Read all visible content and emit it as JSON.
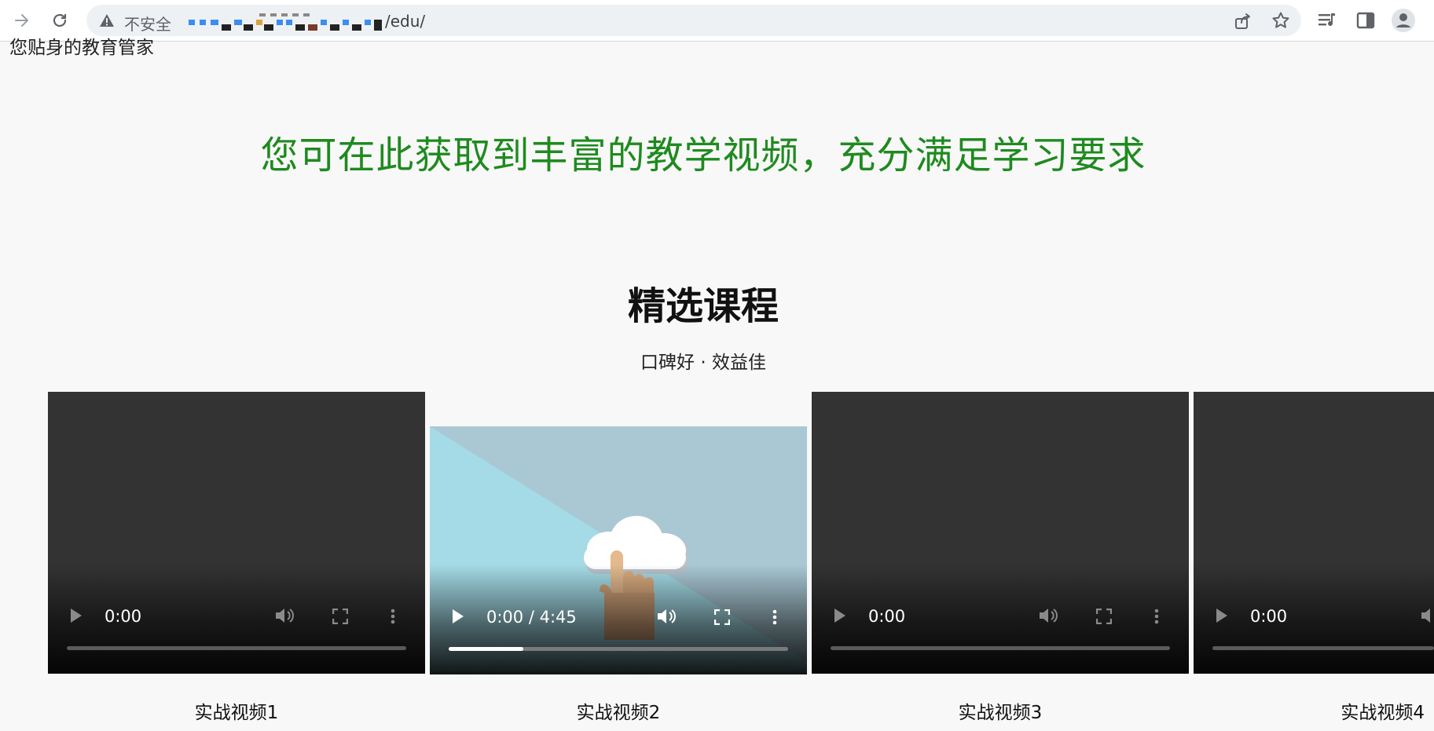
{
  "browser": {
    "security_label": "不安全",
    "url_path": "/edu/"
  },
  "page": {
    "tagline": "您贴身的教育管家",
    "hero_text": "您可在此获取到丰富的教学视频，充分满足学习要求",
    "section_title": "精选课程",
    "section_subtitle": "口碑好 · 效益佳"
  },
  "videos": [
    {
      "label": "实战视频1",
      "time": "0:00",
      "progress": 0
    },
    {
      "label": "实战视频2",
      "time": "0:00 / 4:45",
      "progress": 0.22
    },
    {
      "label": "实战视频3",
      "time": "0:00",
      "progress": 0
    },
    {
      "label": "实战视频4",
      "time": "0:00",
      "progress": 0
    }
  ],
  "colors": {
    "hero": "#1f8a1f",
    "video_bg": "#333333"
  }
}
